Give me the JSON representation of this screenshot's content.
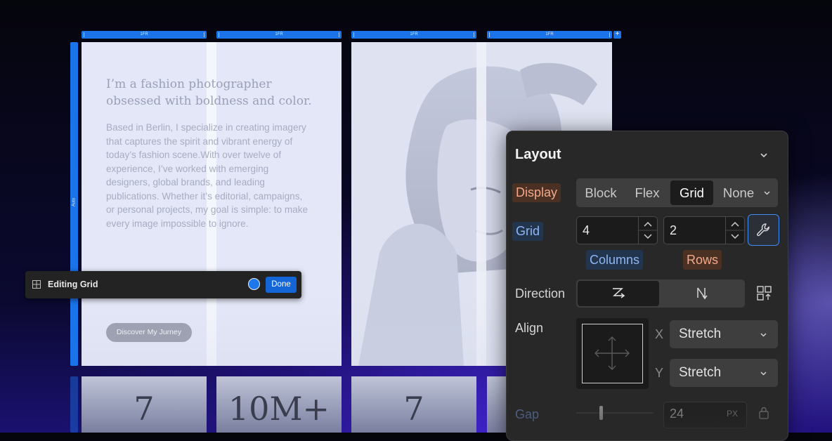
{
  "grid_overlay": {
    "column_tracks": [
      "1FR",
      "1FR",
      "1FR",
      "1FR"
    ],
    "row_track": "Auto",
    "add_track_label": "+"
  },
  "page_content": {
    "headline_line1": "I’m a fashion photographer",
    "headline_line2": "obsessed with boldness and color.",
    "paragraph_lines": [
      "Based in Berlin, I specialize in creating imagery",
      "that captures the spirit and vibrant energy of",
      "today’s fashion scene.With over twelve of",
      "experience, I’ve worked with emerging",
      "designers, global brands, and leading",
      "publications. Whether it’s editorial, campaigns,",
      "or personal projects, my goal is simple: to make",
      "every image impossible to ignore."
    ],
    "cta_label": "Discover My Jurney",
    "stats": [
      "7",
      "10M+",
      "7"
    ]
  },
  "editing_bar": {
    "icon": "grid-icon",
    "title": "Editing Grid",
    "done_label": "Done"
  },
  "layout_panel": {
    "title": "Layout",
    "display": {
      "label": "Display",
      "options": [
        "Block",
        "Flex",
        "Grid",
        "None"
      ],
      "selected": "Grid"
    },
    "grid": {
      "label": "Grid",
      "columns_value": "4",
      "rows_value": "2",
      "columns_label": "Columns",
      "rows_label": "Rows"
    },
    "direction": {
      "label": "Direction"
    },
    "align": {
      "label": "Align",
      "x_label": "X",
      "x_value": "Stretch",
      "y_label": "Y",
      "y_value": "Stretch"
    },
    "gap": {
      "label": "Gap",
      "value": "24",
      "unit": "PX"
    }
  },
  "colors": {
    "accent_blue": "#1a73e8",
    "panel_bg": "#282828",
    "display_badge": "#f3a98a",
    "grid_badge": "#8fb6f3"
  }
}
